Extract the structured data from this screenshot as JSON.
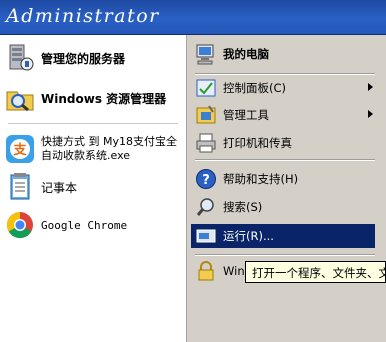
{
  "banner": {
    "user_name": "Administrator"
  },
  "left_items": [
    {
      "name": "manage-server",
      "label": "管理您的服务器",
      "bold": true,
      "icon": "server-icon"
    },
    {
      "name": "windows-explorer",
      "label": "Windows 资源管理器",
      "bold": true,
      "icon": "explorer-icon"
    },
    {
      "name": "my18-shortcut",
      "label": "快捷方式 到 My18支付宝全自动收款系统.exe",
      "bold": false,
      "icon": "my18-app-icon"
    },
    {
      "name": "notepad",
      "label": "记事本",
      "bold": false,
      "icon": "notepad-icon"
    },
    {
      "name": "google-chrome",
      "label": "Google Chrome",
      "bold": false,
      "icon": "chrome-icon"
    }
  ],
  "right_items": [
    {
      "name": "my-computer",
      "label": "我的电脑",
      "bold": true,
      "icon": "computer-icon",
      "submenu": false
    },
    {
      "name": "control-panel",
      "label": "控制面板(C)",
      "bold": false,
      "icon": "control-panel-icon",
      "submenu": true
    },
    {
      "name": "admin-tools",
      "label": "管理工具",
      "bold": false,
      "icon": "admin-tools-icon",
      "submenu": true
    },
    {
      "name": "printers-faxes",
      "label": "打印机和传真",
      "bold": false,
      "icon": "printer-icon",
      "submenu": false
    },
    {
      "name": "help-support",
      "label": "帮助和支持(H)",
      "bold": false,
      "icon": "help-icon",
      "submenu": false
    },
    {
      "name": "search",
      "label": "搜索(S)",
      "bold": false,
      "icon": "search-icon",
      "submenu": false
    },
    {
      "name": "run",
      "label": "运行(R)...",
      "bold": false,
      "icon": "run-icon",
      "submenu": false,
      "selected": true
    },
    {
      "name": "windows-security",
      "label": "Windows 安全",
      "bold": false,
      "icon": "lock-icon",
      "submenu": false
    }
  ],
  "tooltip": {
    "text": "打开一个程序、文件夹、文档或网站。"
  },
  "colors": {
    "banner": "#2a60c4",
    "selection": "#0a246a",
    "right_panel": "#d4d0c8"
  }
}
